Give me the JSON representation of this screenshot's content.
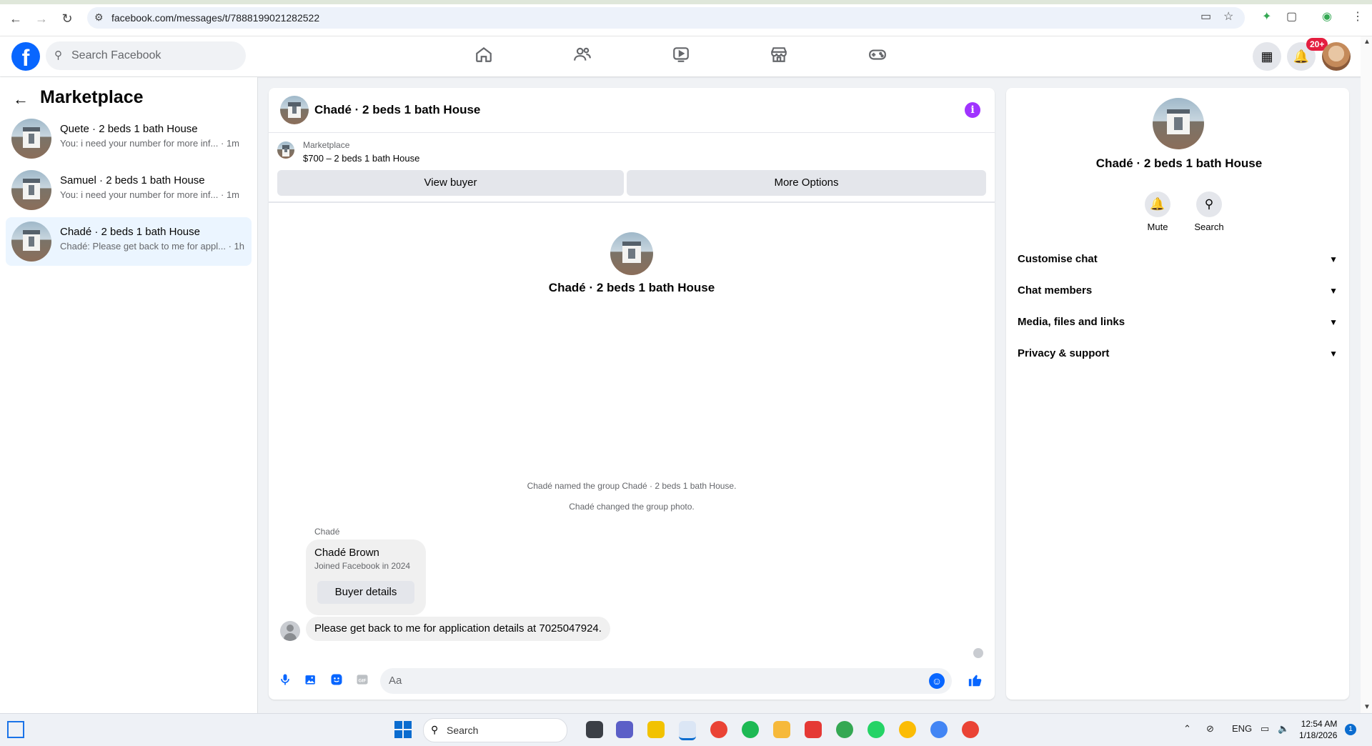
{
  "browser": {
    "url": "facebook.com/messages/t/7888199021282522"
  },
  "fb": {
    "search_placeholder": "Search Facebook",
    "notification_badge": "20+"
  },
  "sidebar": {
    "title": "Marketplace",
    "conversations": [
      {
        "name": "Quete · 2 beds 1 bath House",
        "preview": "You: i need your number for more inf...",
        "time": "· 1m",
        "active": false
      },
      {
        "name": "Samuel · 2 beds 1 bath House",
        "preview": "You: i need your number for more inf...",
        "time": "· 1m",
        "active": false
      },
      {
        "name": "Chadé · 2 beds 1 bath House",
        "preview": "Chadé: Please get back to me for appl...",
        "time": "· 1h",
        "active": true
      }
    ]
  },
  "chat": {
    "title": "Chadé · 2 beds 1 bath House",
    "marketplace_label": "Marketplace",
    "listing": "$700 – 2 beds 1 bath House",
    "view_buyer": "View buyer",
    "more_options": "More Options",
    "center_name": "Chadé · 2 beds 1 bath House",
    "system_messages": [
      "Chadé named the group Chadé · 2 beds 1 bath House.",
      "Chadé changed the group photo."
    ],
    "sender": "Chadé",
    "card": {
      "name": "Chadé Brown",
      "joined": "Joined Facebook in 2024",
      "button": "Buyer details"
    },
    "message": "Please get back to me for application details at 7025047924.",
    "composer_placeholder": "Aa"
  },
  "info": {
    "name": "Chadé · 2 beds 1 bath House",
    "actions": [
      {
        "label": "Mute",
        "icon": "bell-icon"
      },
      {
        "label": "Search",
        "icon": "search-icon"
      }
    ],
    "sections": [
      "Customise chat",
      "Chat members",
      "Media, files and links",
      "Privacy & support"
    ]
  },
  "taskbar": {
    "search": "Search",
    "lang": "ENG",
    "time": "12:54 AM",
    "date": "1/18/2026",
    "badge": "1"
  },
  "colors": {
    "brand": "#0866ff",
    "info_accent": "#a033ff",
    "active_conv": "#ebf5ff",
    "badge_red": "#e41e3f"
  }
}
